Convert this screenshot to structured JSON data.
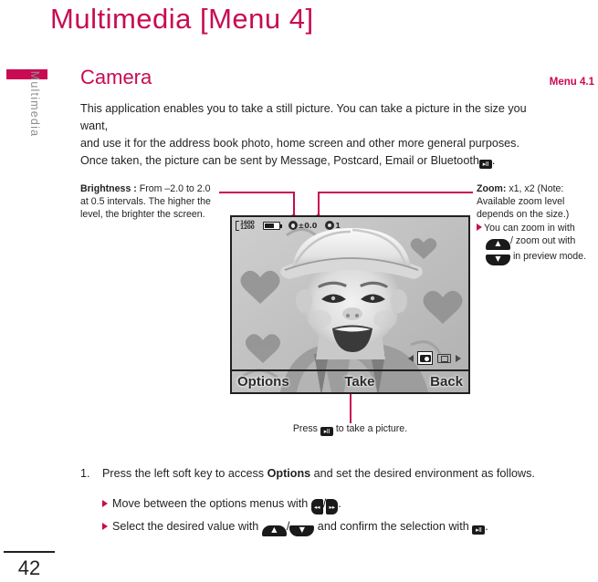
{
  "chapter": {
    "title": "Multimedia [Menu 4]"
  },
  "sidebar": {
    "label": "Multimedia",
    "page_number": "42",
    "tab_color": "#C80B53"
  },
  "section": {
    "title": "Camera",
    "menu_ref": "Menu 4.1",
    "accent_color": "#C80B53"
  },
  "intro": {
    "line1": "This application enables you to take a still picture. You can take a picture in the size you want,",
    "line2": "and use it for the address book photo, home screen and other more general purposes.",
    "line3_pre": "Once taken, the picture can be sent by Message, Postcard, Email or Bluetooth",
    "line3_post": "."
  },
  "callouts": {
    "brightness": {
      "label": "Brightness :",
      "text": " From –2.0 to 2.0 at 0.5 intervals. The higher the level, the brighter the screen."
    },
    "zoom": {
      "label": "Zoom:",
      "text": " x1, x2 (Note: Available zoom level depends on the size.)",
      "bullet_pre": "You can zoom in with ",
      "bullet_mid": "/ zoom out with ",
      "bullet_post": " in preview mode."
    }
  },
  "phone_screen": {
    "status": {
      "resolution_top": "1600",
      "resolution_bottom": "1200",
      "battery_icon": "battery-icon",
      "brightness_icon": "brightness-icon",
      "brightness_value": "±0.0",
      "zoom_icon": "zoom-icon",
      "zoom_value": "1"
    },
    "mode_bar": {
      "left_arrow": "◁",
      "camera_icon": "camera-mode-icon",
      "video_icon": "video-mode-icon",
      "right_arrow": "▷"
    },
    "softkeys": {
      "left": "Options",
      "center": "Take",
      "right": "Back"
    }
  },
  "caption": {
    "pre": "Press ",
    "post": " to take a picture."
  },
  "steps": {
    "num1": "1.",
    "step1_a": "Press the left soft key to access ",
    "step1_b": "Options",
    "step1_c": " and set the desired environment as follows.",
    "bullet1_a": "Move between the options menus with ",
    "bullet1_b": "/",
    "bullet1_c": ".",
    "bullet2_a": "Select the desired value with ",
    "bullet2_b": "/",
    "bullet2_c": "  and confirm the selection with ",
    "bullet2_d": "."
  },
  "key_glyphs": {
    "ok": "▸II",
    "left": "◂◂",
    "right": "▸▸",
    "up": "▲",
    "down": "▼"
  }
}
